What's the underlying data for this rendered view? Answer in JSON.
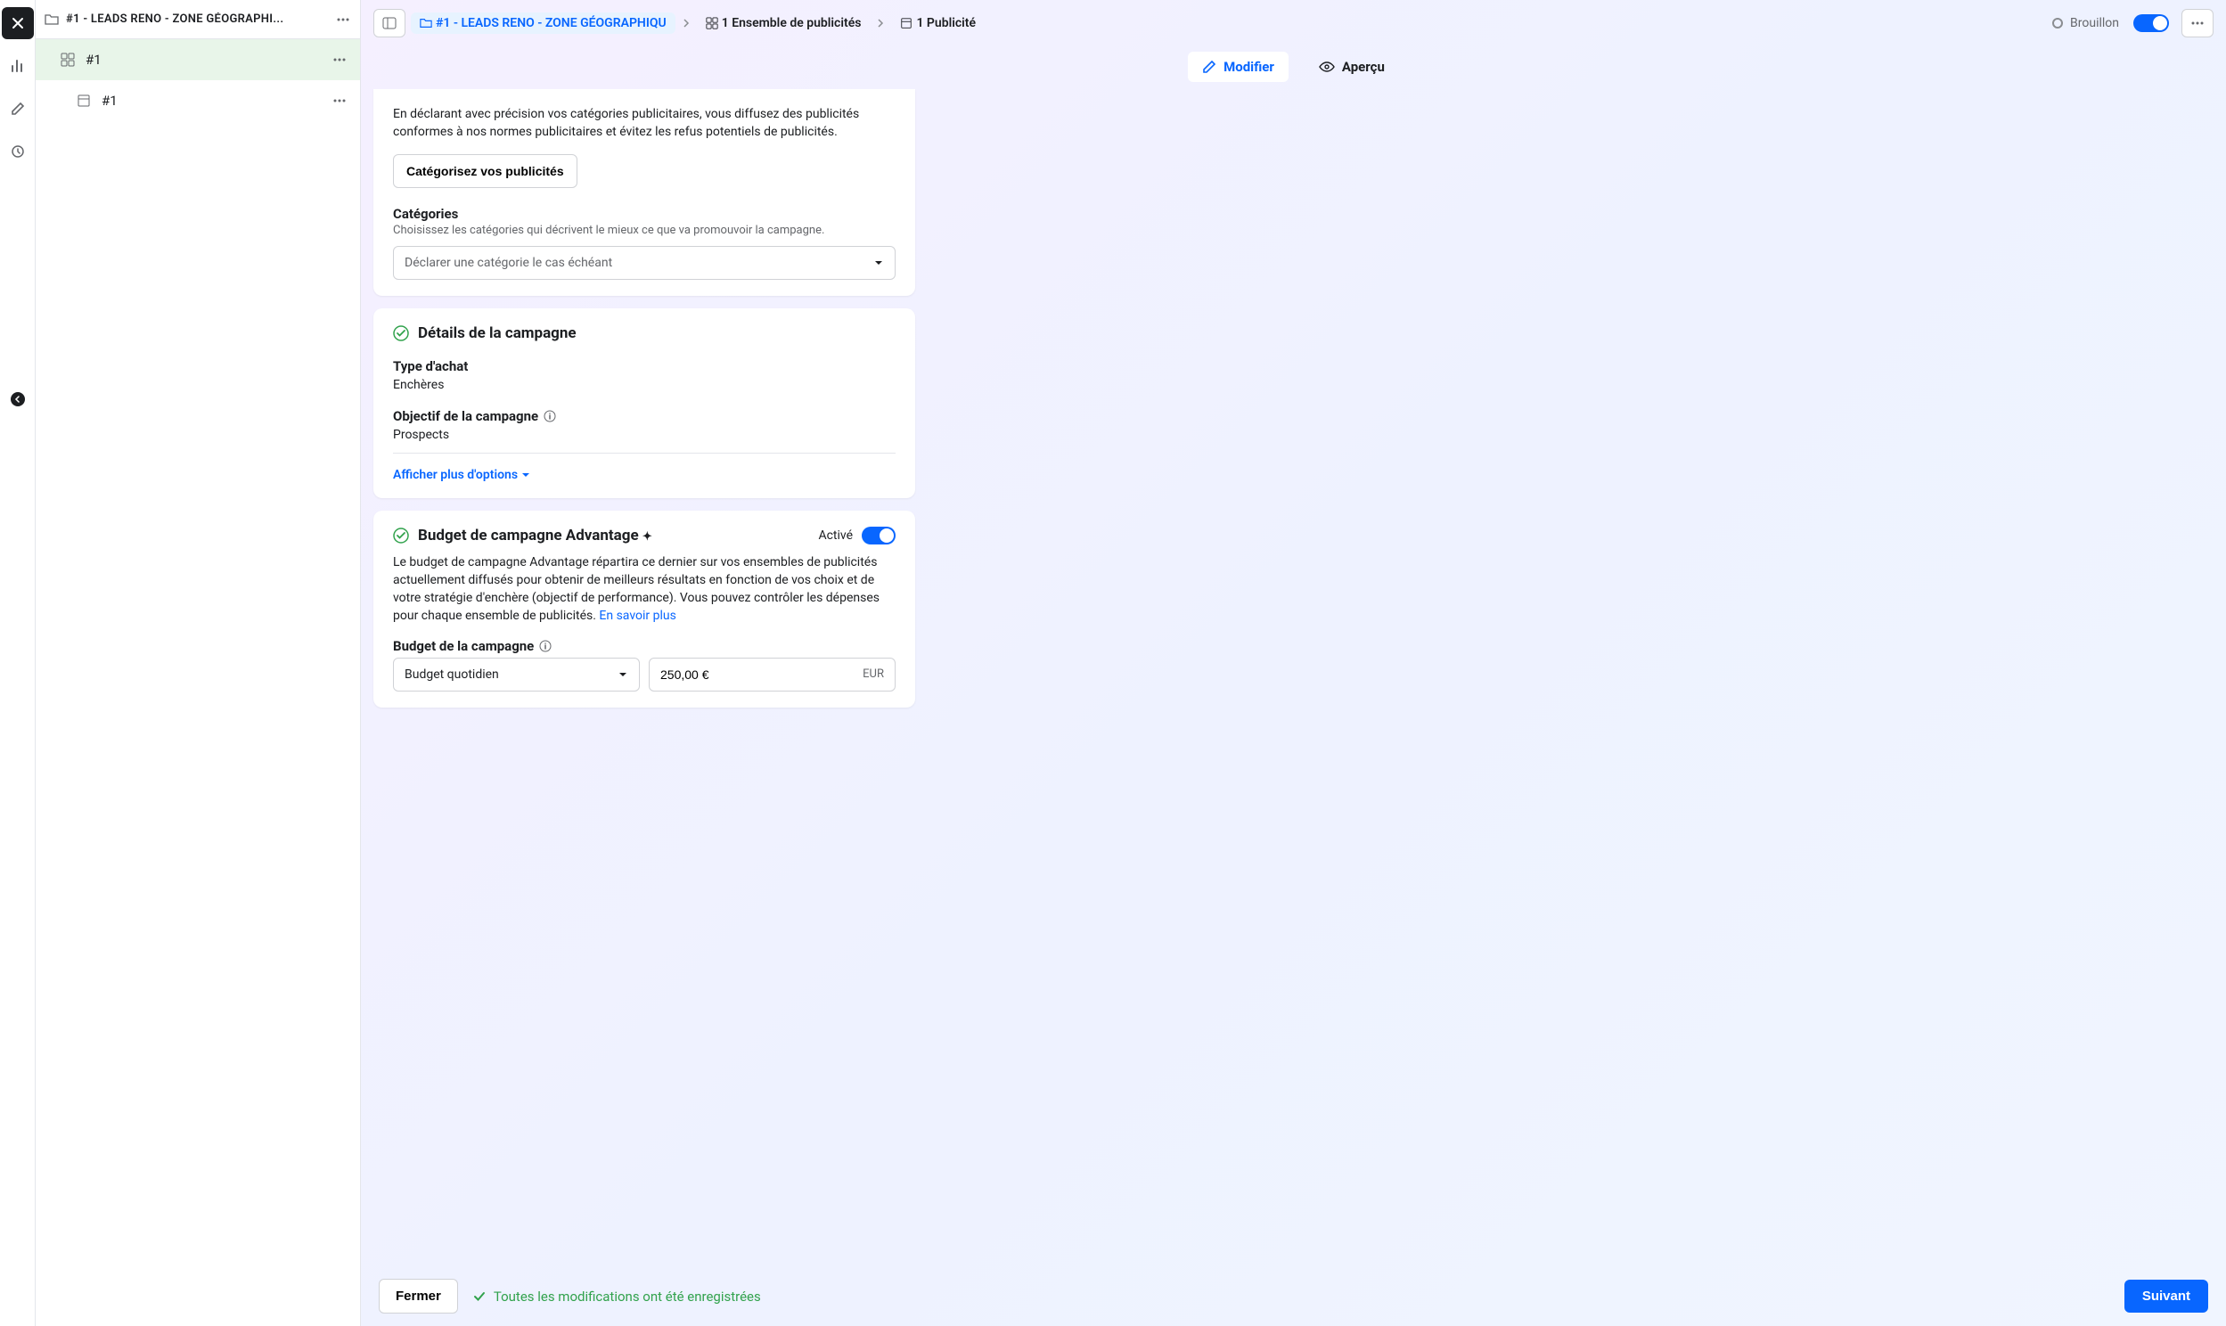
{
  "vrail": {
    "items": [
      "close",
      "chart",
      "edit",
      "history"
    ]
  },
  "left_panel": {
    "title": "#1 - LEADS RENO - ZONE GÉOGRAPHI...",
    "items": [
      {
        "label": "#1",
        "type": "adset",
        "selected": true
      },
      {
        "label": "#1",
        "type": "ad",
        "selected": false
      }
    ]
  },
  "breadcrumb": {
    "campaign": "#1 - LEADS RENO - ZONE GÉOGRAPHIQU",
    "adset": "1 Ensemble de publicités",
    "ad": "1 Publicité"
  },
  "status": {
    "label": "Brouillon",
    "toggle_on": true
  },
  "tabs": {
    "edit": "Modifier",
    "preview": "Aperçu"
  },
  "categories_card": {
    "desc": "En déclarant avec précision vos catégories publicitaires, vous diffusez des publicités conformes à nos normes publicitaires et évitez les refus potentiels de publicités.",
    "button": "Catégorisez vos publicités",
    "section_label": "Catégories",
    "section_hint": "Choisissez les catégories qui décrivent le mieux ce que va promouvoir la campagne.",
    "placeholder": "Déclarer une catégorie le cas échéant"
  },
  "details_card": {
    "title": "Détails de la campagne",
    "purchase_type_label": "Type d'achat",
    "purchase_type_value": "Enchères",
    "objective_label": "Objectif de la campagne",
    "objective_value": "Prospects",
    "show_more": "Afficher plus d'options"
  },
  "budget_card": {
    "title": "Budget de campagne Advantage",
    "enabled_label": "Activé",
    "desc_part1": "Le budget de campagne Advantage répartira ce dernier sur vos ensembles de publicités actuellement diffusés pour obtenir de meilleurs résultats en fonction de vos choix et de votre stratégie d'enchère (objectif de performance). Vous pouvez contrôler les dépenses pour chaque ensemble de publicités. ",
    "learn_more": "En savoir plus",
    "budget_label": "Budget de la campagne",
    "budget_type": "Budget quotidien",
    "budget_value": "250,00 €",
    "budget_currency": "EUR"
  },
  "footer": {
    "close": "Fermer",
    "saved": "Toutes les modifications ont été enregistrées",
    "next": "Suivant"
  }
}
